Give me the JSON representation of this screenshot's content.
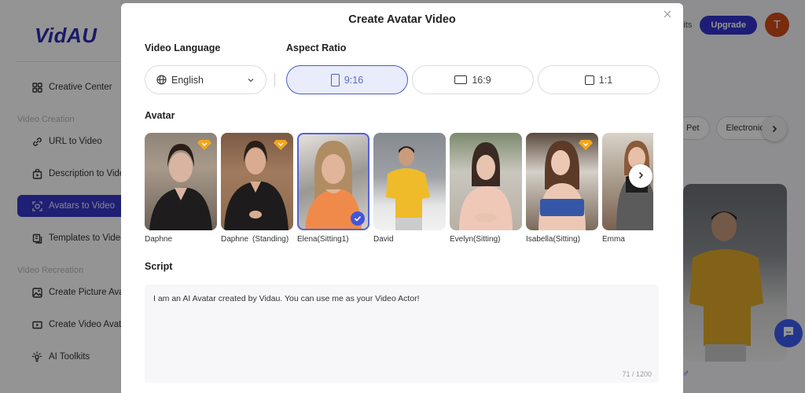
{
  "app": {
    "logo": "VidAU",
    "sidebar": {
      "items": [
        {
          "label": "Creative Center",
          "icon": "grid-icon"
        },
        {
          "label": "URL to Video",
          "icon": "link-icon"
        },
        {
          "label": "Description to Video",
          "icon": "bag-play-icon"
        },
        {
          "label": "Avatars to Video",
          "icon": "avatar-scan-icon",
          "active": true
        },
        {
          "label": "Templates to Video",
          "icon": "template-icon"
        },
        {
          "label": "Create Picture Avatar",
          "icon": "image-icon"
        },
        {
          "label": "Create Video Avatar",
          "icon": "video-play-icon"
        },
        {
          "label": "AI Toolkits",
          "icon": "bulb-icon"
        }
      ],
      "sections": {
        "video_creation": "Video Creation",
        "video_recreation": "Video Recreation"
      }
    },
    "topbar": {
      "credits_label": "Credits",
      "upgrade_label": "Upgrade",
      "user_initial": "T"
    },
    "category_chips": [
      "Pet",
      "Electronic D"
    ],
    "accent_color": "#3333cc"
  },
  "modal": {
    "title": "Create Avatar Video",
    "close_icon": "close-icon",
    "video_language": {
      "label": "Video Language",
      "value": "English"
    },
    "aspect_ratio": {
      "label": "Aspect Ratio",
      "options": [
        {
          "label": "9:16",
          "selected": true
        },
        {
          "label": "16:9",
          "selected": false
        },
        {
          "label": "1:1",
          "selected": false
        }
      ]
    },
    "avatar": {
      "label": "Avatar",
      "items": [
        {
          "name": "Daphne",
          "premium": true,
          "selected": false
        },
        {
          "name": "Daphne (Standing)",
          "premium": true,
          "selected": false
        },
        {
          "name": "Elena(Sitting1)",
          "premium": false,
          "selected": true
        },
        {
          "name": "David",
          "premium": false,
          "selected": false
        },
        {
          "name": "Evelyn(Sitting)",
          "premium": false,
          "selected": false
        },
        {
          "name": "Isabella(Sitting)",
          "premium": true,
          "selected": false
        },
        {
          "name": "Emma",
          "premium": false,
          "selected": false
        }
      ]
    },
    "script": {
      "label": "Script",
      "value": "I am an AI Avatar created by Vidau. You can use me as your Video Actor!",
      "char_count": "71 / 1200"
    }
  }
}
